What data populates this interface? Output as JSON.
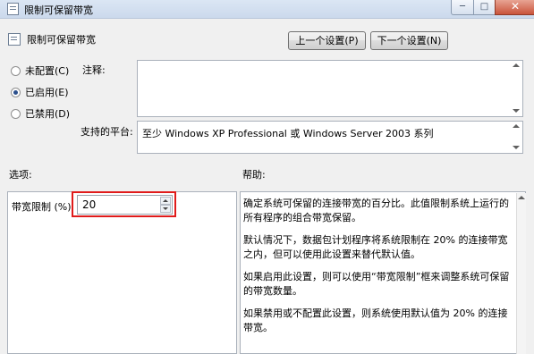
{
  "window": {
    "title": "限制可保留带宽",
    "controls": {
      "minimize": "─",
      "maximize": "□",
      "close": "✕"
    }
  },
  "header": {
    "title": "限制可保留带宽",
    "prev_button": "上一个设置(P)",
    "next_button": "下一个设置(N)"
  },
  "state": {
    "options": [
      {
        "label": "未配置(C)",
        "selected": false
      },
      {
        "label": "已启用(E)",
        "selected": true
      },
      {
        "label": "已禁用(D)",
        "selected": false
      }
    ]
  },
  "comment": {
    "label": "注释:",
    "value": ""
  },
  "supported": {
    "label": "支持的平台:",
    "value": "至少 Windows XP Professional 或 Windows Server 2003 系列"
  },
  "options_section": {
    "label": "选项:",
    "bandwidth_label": "带宽限制 (%):",
    "bandwidth_value": "20"
  },
  "help_section": {
    "label": "帮助:",
    "paragraphs": [
      "确定系统可保留的连接带宽的百分比。此值限制系统上运行的所有程序的组合带宽保留。",
      "默认情况下，数据包计划程序将系统限制在 20% 的连接带宽之内，但可以使用此设置来替代默认值。",
      "如果启用此设置，则可以使用“带宽限制”框来调整系统可保留的带宽数量。",
      "如果禁用或不配置此设置，则系统使用默认值为 20% 的连接带宽。"
    ]
  }
}
